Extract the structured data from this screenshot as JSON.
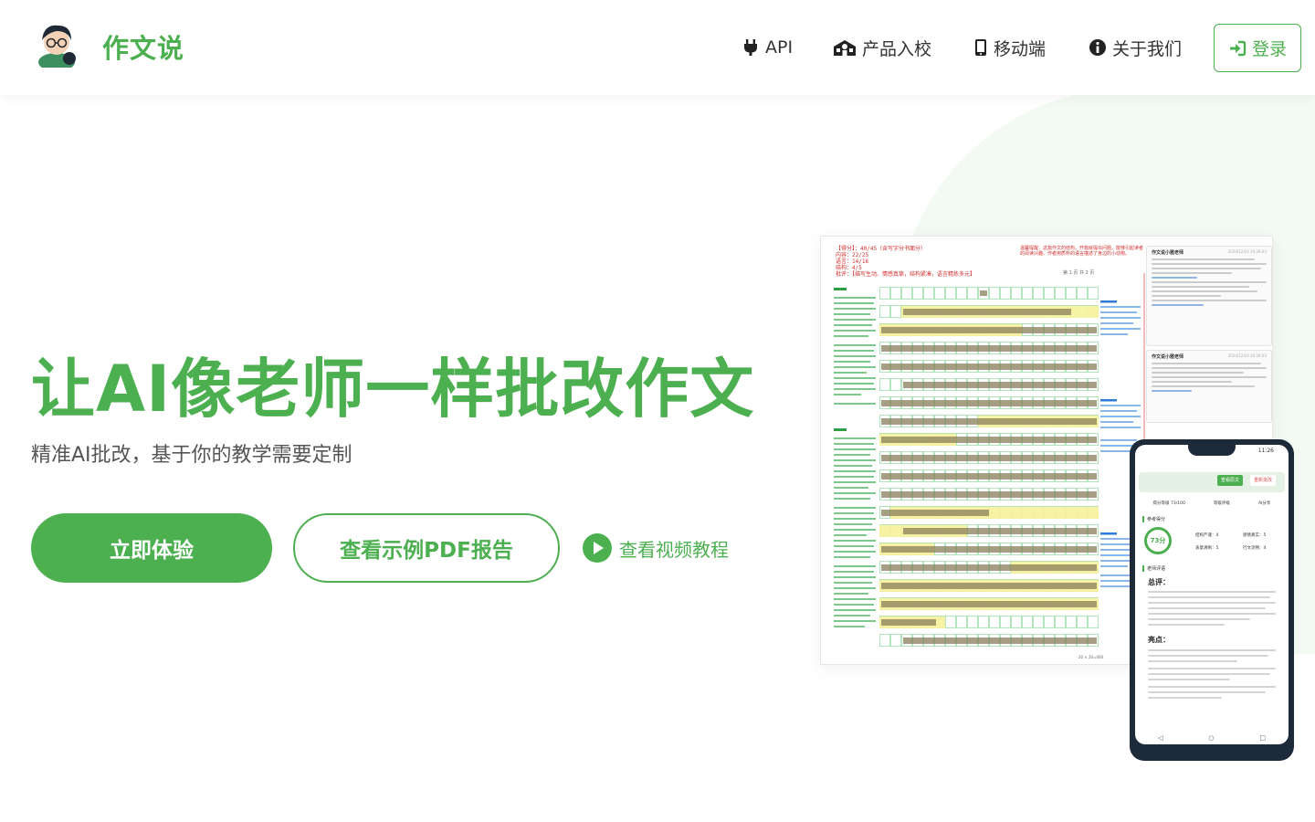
{
  "brand": {
    "name": "作文说"
  },
  "nav": {
    "items": [
      {
        "label": "API",
        "icon": "plug-icon"
      },
      {
        "label": "产品入校",
        "icon": "school-icon"
      },
      {
        "label": "移动端",
        "icon": "mobile-icon"
      },
      {
        "label": "关于我们",
        "icon": "info-icon"
      }
    ],
    "login_label": "登录",
    "login_icon": "login-arrow-icon"
  },
  "hero": {
    "title": "让AI像老师一样批改作文",
    "subtitle": "精准AI批改，基于你的教学需要定制",
    "primary_button": "立即体验",
    "secondary_button": "查看示例PDF报告",
    "video_link": "查看视频教程"
  },
  "preview": {
    "doc_score_lines": [
      "【得分】：40/45（含写字分书面分）",
      "内容：22/25",
      "语言：14/16",
      "结构：4/5",
      "批评：【描写生动、情感真挚，结构紧凑，语言精炼多元】"
    ],
    "doc_topnote": "温馨提醒：这篇作文的结构，开篇就提出问题，能够引起读者的阅读兴趣。作者用质朴的语言描述了身边的小动物。",
    "doc_pagenum": "第 1 页 共 2 页",
    "doc_foot": "20 × 20=400",
    "comment_author": "作文说小雅老师",
    "comment_date": "2024/12/24 10:26:03",
    "phone_time": "11:26",
    "phone_chip_1": "查看原文",
    "phone_chip_2": "重新批改",
    "phone_stats": [
      "得分等级 73/100",
      "等级评级",
      "AI分享"
    ],
    "phone_section_1": "参考得分",
    "phone_score": "73分",
    "phone_kv": [
      "结构严谨：4",
      "感情真实：5",
      "表意清晰：5",
      "行文流畅：4"
    ],
    "phone_section_2": "老师评语",
    "phone_h1": "总评：",
    "phone_h2": "亮点："
  },
  "colors": {
    "brand": "#4caf50",
    "text": "#333333",
    "doc_red": "#d32f2f",
    "doc_green": "#2e9e44",
    "doc_blue": "#2e7bd8"
  }
}
